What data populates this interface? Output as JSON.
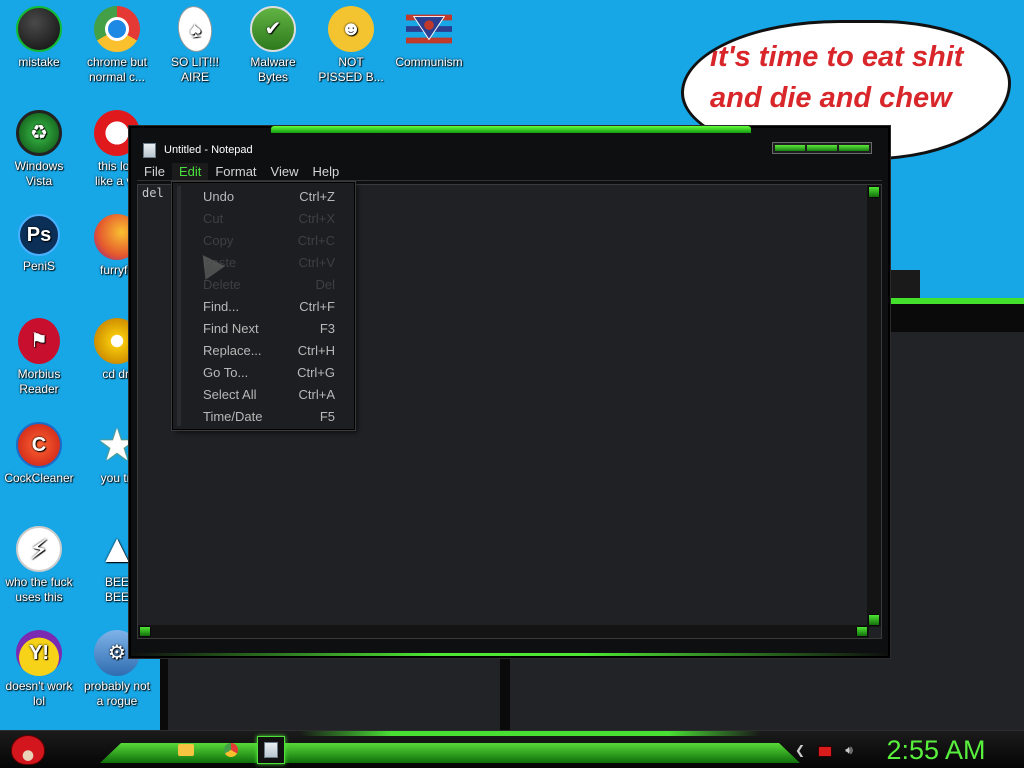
{
  "desktop": {
    "icons": [
      {
        "label": "mistake",
        "glyph": ""
      },
      {
        "label": "chrome but\nnormal c...",
        "glyph": ""
      },
      {
        "label": "SO LIT!!!\nAIRE",
        "glyph": "♠"
      },
      {
        "label": "Malware\nBytes",
        "glyph": "✔"
      },
      {
        "label": "NOT\nPISSED B...",
        "glyph": "☻"
      },
      {
        "label": "Communism",
        "glyph": ""
      },
      {
        "label": "Windows\nVista",
        "glyph": "♻"
      },
      {
        "label": "this loo\nlike a va",
        "glyph": ""
      },
      {
        "label": "PeniS",
        "glyph": "Ps"
      },
      {
        "label": "furryfo",
        "glyph": ""
      },
      {
        "label": "Morbius\nReader",
        "glyph": "⚑"
      },
      {
        "label": "cd dri",
        "glyph": ""
      },
      {
        "label": "CockCleaner",
        "glyph": "C"
      },
      {
        "label": "you tri",
        "glyph": "★"
      },
      {
        "label": "who the fuck\nuses this",
        "glyph": "⚡"
      },
      {
        "label": "BEE\nBEE",
        "glyph": "▲"
      },
      {
        "label": "doesn't work\nlol",
        "glyph": "Y!"
      },
      {
        "label": "probably not\na rogue",
        "glyph": "⚙"
      }
    ]
  },
  "speech_bubble": {
    "text": "it's time to eat shit and die and chew bubble"
  },
  "notepad": {
    "title": "Untitled - Notepad",
    "menu": [
      "File",
      "Edit",
      "Format",
      "View",
      "Help"
    ],
    "active_menu": "Edit",
    "content": "del",
    "edit_menu": [
      {
        "label": "Undo",
        "shortcut": "Ctrl+Z",
        "enabled": true
      },
      {
        "label": "Cut",
        "shortcut": "Ctrl+X",
        "enabled": false
      },
      {
        "label": "Copy",
        "shortcut": "Ctrl+C",
        "enabled": false
      },
      {
        "label": "Paste",
        "shortcut": "Ctrl+V",
        "enabled": false
      },
      {
        "label": "Delete",
        "shortcut": "Del",
        "enabled": false
      },
      {
        "label": "Find...",
        "shortcut": "Ctrl+F",
        "enabled": true
      },
      {
        "label": "Find Next",
        "shortcut": "F3",
        "enabled": true
      },
      {
        "label": "Replace...",
        "shortcut": "Ctrl+H",
        "enabled": true
      },
      {
        "label": "Go To...",
        "shortcut": "Ctrl+G",
        "enabled": true
      },
      {
        "label": "Select All",
        "shortcut": "Ctrl+A",
        "enabled": true
      },
      {
        "label": "Time/Date",
        "shortcut": "F5",
        "enabled": true
      }
    ]
  },
  "taskbar": {
    "clock": "2:55 AM",
    "pinned": [
      "file-explorer-icon",
      "chrome-icon",
      "notepad-icon"
    ]
  },
  "colors": {
    "desktop_bg": "#17a6e6",
    "accent_green": "#49e03a",
    "bubble_text": "#d8262a"
  }
}
